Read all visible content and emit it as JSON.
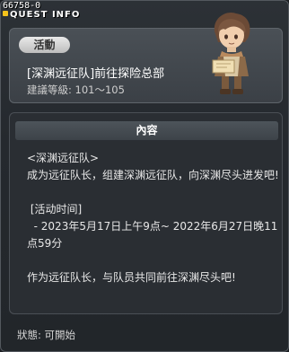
{
  "window": {
    "id": "66758-0",
    "title": "QUEST INFO"
  },
  "quest": {
    "badge": "活動",
    "name": "[深渊远征队]前往探险总部",
    "level": "建議等級: 101～105"
  },
  "content": {
    "header": "內容",
    "lines": [
      "<深渊远征队>",
      "成为远征队长，组建深渊远征队，向深渊尽头进发吧!",
      "",
      " [活动时间]",
      "  - 2023年5月17日上午9点~ 2022年6月27日晚11点59分",
      "",
      "作为远征队长，与队员共同前往深渊尽头吧!"
    ]
  },
  "status": "狀態: 可開始"
}
